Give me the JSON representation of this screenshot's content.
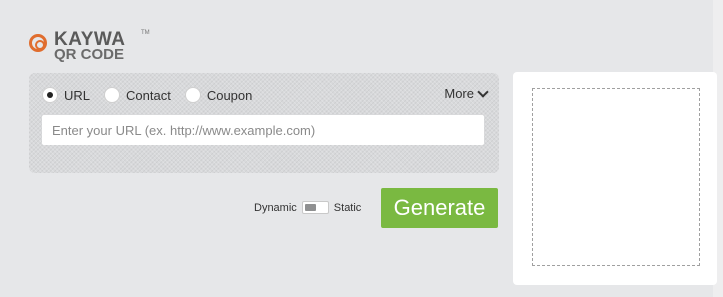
{
  "logo": {
    "name": "KAYWA",
    "tm": "TM",
    "subtitle": "QR CODE"
  },
  "types": {
    "url": "URL",
    "contact": "Contact",
    "coupon": "Coupon",
    "more": "More"
  },
  "url_input": {
    "placeholder": "Enter your URL (ex. http://www.example.com)",
    "value": ""
  },
  "toggle": {
    "dynamic": "Dynamic",
    "static": "Static"
  },
  "generate": {
    "label": "Generate"
  },
  "colors": {
    "accent_green": "#7ab941",
    "logo_orange": "#e06d2e"
  },
  "icons": {
    "more": "chevron-down-icon",
    "logo": "kaywa-logo-icon"
  }
}
